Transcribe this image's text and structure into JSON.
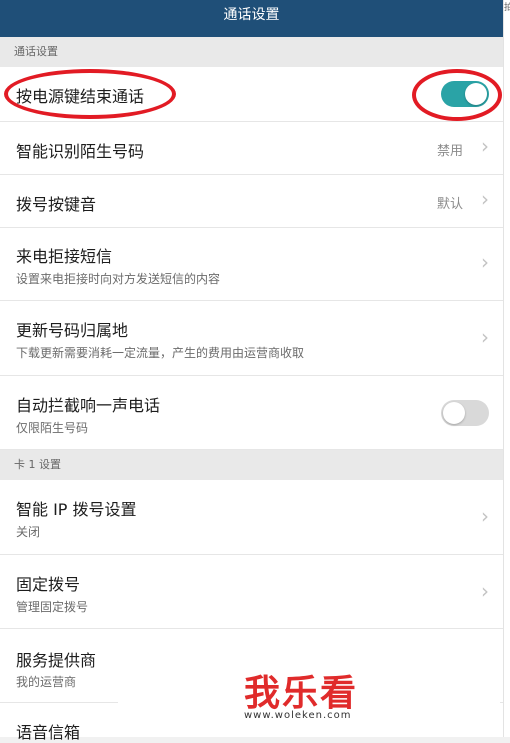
{
  "header": {
    "title": "通话设置"
  },
  "corner_glyph": "拍",
  "sections": {
    "call_settings": "通话设置",
    "card1": "卡 1 设置"
  },
  "rows": {
    "end_call_power": {
      "title": "按电源键结束通话",
      "toggle": "on"
    },
    "smart_id": {
      "title": "智能识别陌生号码",
      "value": "禁用"
    },
    "dial_tone": {
      "title": "拨号按键音",
      "value": "默认"
    },
    "reject_sms": {
      "title": "来电拒接短信",
      "subtitle": "设置来电拒接时向对方发送短信的内容"
    },
    "update_location": {
      "title": "更新号码归属地",
      "subtitle": "下载更新需要消耗一定流量，产生的费用由运营商收取"
    },
    "block_one_ring": {
      "title": "自动拦截响一声电话",
      "subtitle": "仅限陌生号码",
      "toggle": "off"
    },
    "smart_ip": {
      "title": "智能 IP 拨号设置",
      "subtitle": "关闭"
    },
    "fixed_dial": {
      "title": "固定拨号",
      "subtitle": "管理固定拨号"
    },
    "provider": {
      "title": "服务提供商",
      "subtitle": "我的运营商"
    },
    "voicemail": {
      "title": "语音信箱"
    }
  },
  "watermark": {
    "text": "我乐看",
    "url": "www.woleken.com"
  },
  "colors": {
    "header": "#1f4f78",
    "toggle_on": "#2aa3a6",
    "annotation": "#e21b24"
  }
}
